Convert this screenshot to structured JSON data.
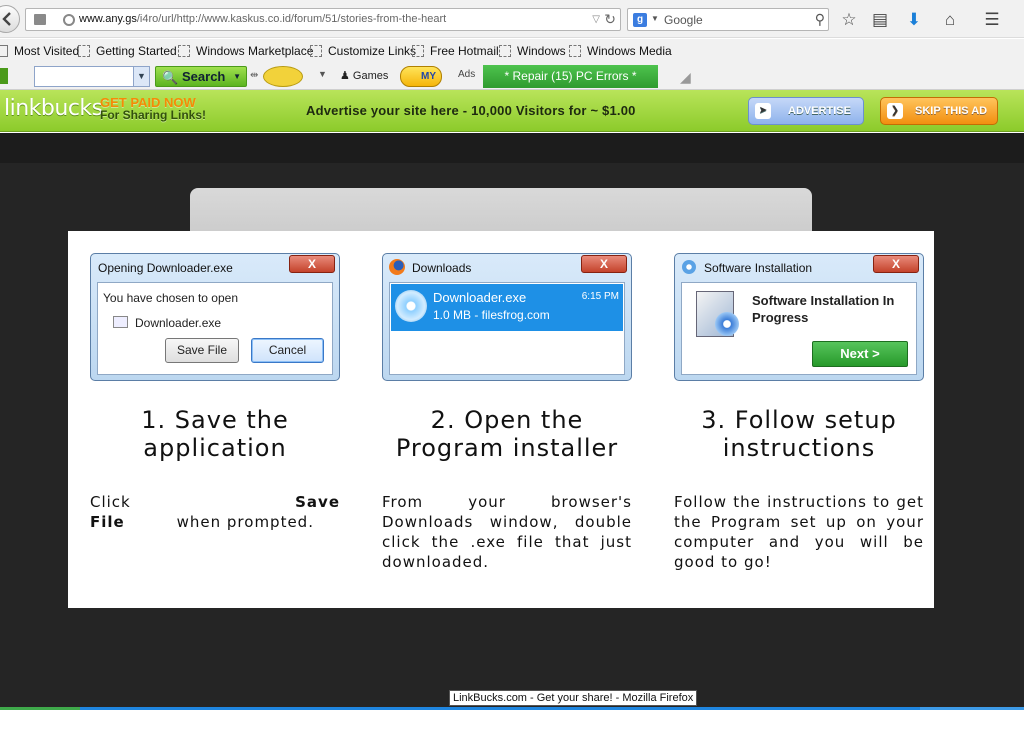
{
  "browser": {
    "url_domain": "www.any.gs",
    "url_path": "/i4ro/url/http://www.kaskus.co.id/forum/51/stories-from-the-heart",
    "search_placeholder": "Google",
    "search_engine_letter": "g"
  },
  "bookmarks": [
    "Most Visited",
    "Getting Started",
    "Windows Marketplace",
    "Customize Links",
    "Free Hotmail",
    "Windows",
    "Windows Media"
  ],
  "toolbar": {
    "search_label": "Search",
    "games_label": "Games",
    "my_label": "MY",
    "ads_label": "Ads",
    "repair_label": "* Repair (15) PC Errors *"
  },
  "adbar": {
    "logo": "linkbucks",
    "get_paid": "GET PAID NOW",
    "sharing": "For Sharing Links!",
    "ad_text": "Advertise your site here - 10,000 Visitors for ~ $1.00",
    "advertise_label": "ADVERTISE",
    "skip_label": "SKIP THIS AD"
  },
  "steps": [
    {
      "window_title": "Opening Downloader.exe",
      "chosen_text": "You have chosen to open",
      "file_name": "Downloader.exe",
      "save_label": "Save File",
      "cancel_label": "Cancel",
      "heading": "1. Save the application",
      "body_prefix": "Click",
      "body_bold": "Save File",
      "body_suffix": "when prompted."
    },
    {
      "window_title": "Downloads",
      "file_name": "Downloader.exe",
      "file_info": "1.0 MB - filesfrog.com",
      "time": "6:15 PM",
      "heading": "2. Open the Program installer",
      "body": "From your browser's Downloads window, double click the .exe file that just downloaded."
    },
    {
      "window_title": "Software Installation",
      "message": "Software Installation In Progress",
      "next_label": "Next >",
      "heading": "3. Follow setup instructions",
      "body": "Follow the instructions to get the Program set up on your computer and you will be good to go!"
    }
  ],
  "close_glyph": "X",
  "taskbar_tip": "LinkBucks.com - Get your share! - Mozilla Firefox",
  "colors": {
    "ad_green": "#8ccb2b",
    "repair_green": "#2f9b2f",
    "download_blue": "#1e90e6",
    "skip_orange": "#f28f10"
  }
}
